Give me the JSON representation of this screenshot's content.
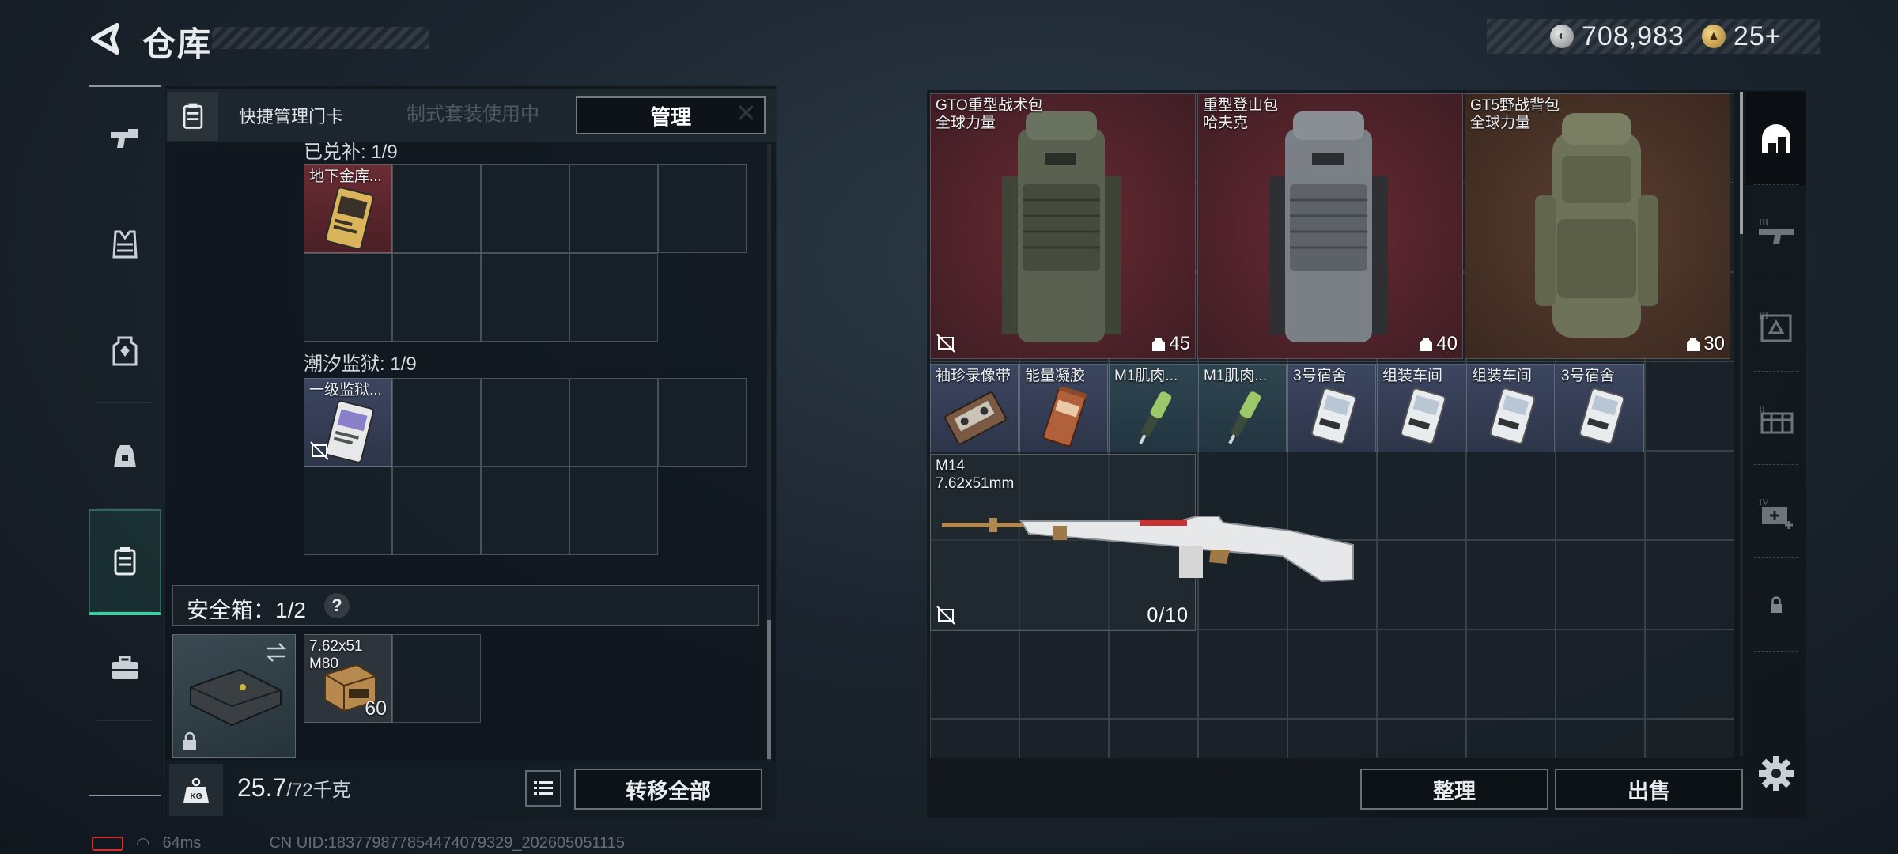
{
  "header": {
    "title": "仓库",
    "currency_silver": "708,983",
    "currency_gold": "25+"
  },
  "sidebar": {
    "items": [
      {
        "name": "weapons",
        "icon": "pistol-icon"
      },
      {
        "name": "armor",
        "icon": "vest-icon"
      },
      {
        "name": "backpack-slot",
        "icon": "backpack-icon"
      },
      {
        "name": "rig",
        "icon": "pack-icon"
      },
      {
        "name": "container",
        "icon": "safebox-icon",
        "active": true
      },
      {
        "name": "toolkit",
        "icon": "briefcase-icon"
      }
    ]
  },
  "left_panel": {
    "quick_label": "快捷管理门卡",
    "quick_ghost_text": "制式套装使用中",
    "manage_label": "管理",
    "section1_label": "已兑补: 1/9",
    "section1_item": "地下金库...",
    "section2_label": "潮汐监狱: 1/9",
    "section2_item": "一级监狱...",
    "safebox_label": "安全箱：1/2",
    "safebox_help": "?",
    "ammo_name": "7.62x51",
    "ammo_sub": "M80",
    "ammo_count": "60",
    "weight_value": "25.7",
    "weight_unit": "/72千克",
    "kg_label": "KG",
    "transfer_label": "转移全部"
  },
  "stash": {
    "backpacks": [
      {
        "name": "GTO重型战术包",
        "brand": "全球力量",
        "count": "45",
        "bg": "red"
      },
      {
        "name": "重型登山包",
        "brand": "哈夫克",
        "count": "40",
        "bg": "red"
      },
      {
        "name": "GT5野战背包",
        "brand": "全球力量",
        "count": "30",
        "bg": "brown"
      }
    ],
    "small_items": [
      {
        "name": "袖珍录像带",
        "bg": "purple"
      },
      {
        "name": "能量凝胶",
        "bg": "purple"
      },
      {
        "name": "M1肌肉...",
        "bg": "teal"
      },
      {
        "name": "M1肌肉...",
        "bg": "teal"
      },
      {
        "name": "3号宿舍",
        "bg": "purple"
      },
      {
        "name": "组装车间",
        "bg": "purple"
      },
      {
        "name": "组装车间",
        "bg": "purple"
      },
      {
        "name": "3号宿舍",
        "bg": "purple"
      }
    ],
    "rifle": {
      "name": "M14",
      "caliber": "7.62x51mm",
      "ammo": "0/10"
    },
    "sort_label": "整理",
    "sell_label": "出售"
  },
  "right_tabs": [
    "home-icon",
    "tier3-weapon-icon",
    "tier3-case-icon",
    "tier2-crate-icon",
    "tier4-medkit-icon",
    "lock-icon"
  ],
  "status": {
    "ping": "64ms",
    "uid": "CN UID:18377987785447407932​9_202605051115"
  },
  "colors": {
    "accent": "#3ad0a4",
    "backpack_red": "#5a2530",
    "backpack_brown": "#4e3628",
    "item_purple": "#3a4460",
    "item_teal": "#2b404b"
  }
}
